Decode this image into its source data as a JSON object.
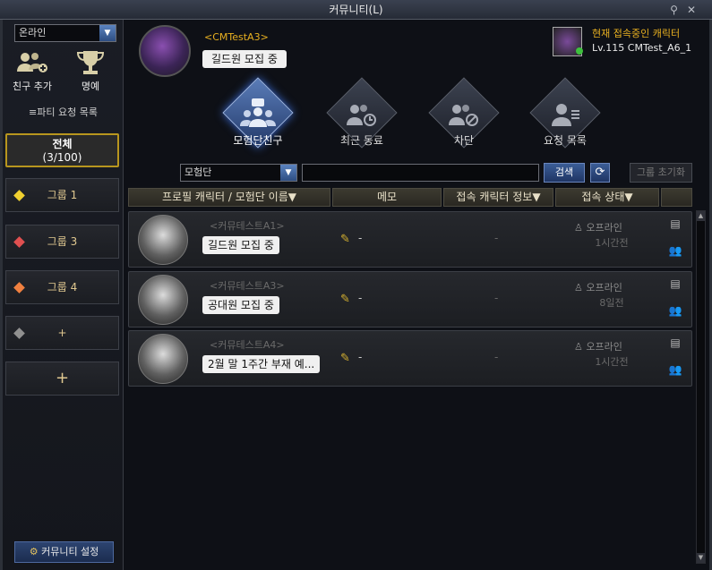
{
  "window": {
    "title": "커뮤니티(L)"
  },
  "sidebar": {
    "status_select": "온라인",
    "add_friend_label": "친구 추가",
    "honor_label": "명예",
    "party_request_label": "≡파티 요청 목록",
    "all_group": {
      "label": "전체",
      "count": "(3/100)"
    },
    "groups": [
      {
        "label": "그룹 1",
        "color": "#f0d030"
      },
      {
        "label": "그룹 3",
        "color": "#e05050"
      },
      {
        "label": "그룹 4",
        "color": "#f08040"
      },
      {
        "label": "+",
        "color": "#909090"
      }
    ],
    "add_group_label": "+",
    "settings_label": "커뮤니티 설정"
  },
  "me": {
    "name": "<CMTestA3>",
    "message": "길드원 모집 중"
  },
  "current_character": {
    "label": "현재 접속중인 캐릭터",
    "name": "Lv.115 CMTest_A6_1"
  },
  "tabs": [
    {
      "label": "모험단친구",
      "icon": "group-icon",
      "active": true
    },
    {
      "label": "최근 동료",
      "icon": "recent-party-icon",
      "active": false
    },
    {
      "label": "차단",
      "icon": "block-icon",
      "active": false
    },
    {
      "label": "요청 목록",
      "icon": "request-list-icon",
      "active": false
    }
  ],
  "filter": {
    "select": "모험단",
    "search_button": "검색",
    "reset_button": "그룹 초기화"
  },
  "table": {
    "headers": [
      "프로필 캐릭터 / 모험단 이름▼",
      "메모",
      "접속 캐릭터 정보▼",
      "접속 상태▼"
    ],
    "rows": [
      {
        "name": "<커뮤테스트A1>",
        "message": "길드원 모집 중",
        "memo": "-",
        "char_info": "-",
        "status": "오프라인",
        "last_seen": "1시간전"
      },
      {
        "name": "<커뮤테스트A3>",
        "message": "공대원 모집 중",
        "memo": "-",
        "char_info": "-",
        "status": "오프라인",
        "last_seen": "8일전"
      },
      {
        "name": "<커뮤테스트A4>",
        "message": "2월 말 1주간 부재 예...",
        "memo": "-",
        "char_info": "-",
        "status": "오프라인",
        "last_seen": "1시간전"
      }
    ]
  }
}
